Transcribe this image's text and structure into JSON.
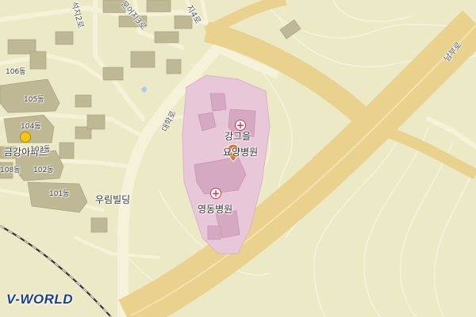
{
  "map": {
    "colors": {
      "background": "#eceac6",
      "buildings": "#bfb894",
      "hospital_area": "#e8c7d8",
      "hospital_buildings": "#d6a9c3",
      "road": "#f6f2d9",
      "expressway": "#e9d18e",
      "contour": "#f5f4e3",
      "railway": "#333333",
      "pin": "#e66a1e"
    },
    "pois": [
      {
        "name": "강그을요양병원",
        "line1": "강그을",
        "line2": "요양병원",
        "icon": "hospital-icon"
      },
      {
        "name": "영동병원",
        "icon": "hospital-icon"
      },
      {
        "name": "우림빌딩"
      },
      {
        "name": "금강아파트",
        "icon": "apartment-icon"
      }
    ],
    "buildings": [
      "106동",
      "105동",
      "104동",
      "103동",
      "102동",
      "101동",
      "108동"
    ],
    "roads": [
      "대학로",
      "남부로",
      "석지2로",
      "문어지3로",
      "지4로"
    ],
    "selected_marker": "location-pin-icon",
    "logo": "V-WORLD"
  }
}
